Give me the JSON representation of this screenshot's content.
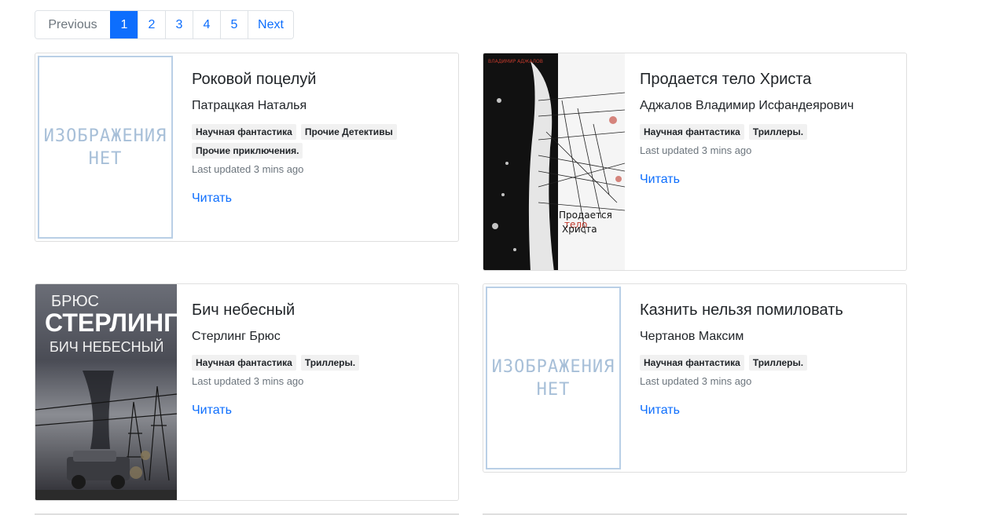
{
  "pagination": {
    "previous": "Previous",
    "pages": [
      "1",
      "2",
      "3",
      "4",
      "5"
    ],
    "active_page": "1",
    "next": "Next"
  },
  "books": [
    {
      "title": "Роковой поцелуй",
      "author": "Патрацкая Наталья",
      "tags": [
        "Научная фантастика",
        "Прочие Детективы",
        "Прочие приключения."
      ],
      "updated": "Last updated 3 mins ago",
      "read_label": "Читать",
      "cover": {
        "type": "placeholder",
        "lines": [
          "ИЗОБРАЖЕНИЯ",
          "НЕТ"
        ]
      }
    },
    {
      "title": "Продается тело Христа",
      "author": "Аджалов Владимир Исфандеярович",
      "tags": [
        "Научная фантастика",
        "Триллеры."
      ],
      "updated": "Last updated 3 mins ago",
      "read_label": "Читать",
      "cover": {
        "type": "image",
        "caption_1": "Продается",
        "caption_2": "тело",
        "caption_3": "Христа",
        "top_text": "ВЛАДИМИР АДЖАЛОВ"
      }
    },
    {
      "title": "Бич небесный",
      "author": "Стерлинг Брюс",
      "tags": [
        "Научная фантастика",
        "Триллеры."
      ],
      "updated": "Last updated 3 mins ago",
      "read_label": "Читать",
      "cover": {
        "type": "image",
        "line_1": "БРЮС",
        "line_2": "СТЕРЛИНГ",
        "line_3": "БИЧ НЕБЕСНЫЙ"
      }
    },
    {
      "title": "Казнить нельзя помиловать",
      "author": "Чертанов Максим",
      "tags": [
        "Научная фантастика",
        "Триллеры."
      ],
      "updated": "Last updated 3 mins ago",
      "read_label": "Читать",
      "cover": {
        "type": "placeholder",
        "lines": [
          "ИЗОБРАЖЕНИЯ",
          "НЕТ"
        ]
      }
    }
  ],
  "colors": {
    "link": "#0d6efd",
    "active_page_bg": "#0d6efd",
    "muted": "#6c757d"
  }
}
